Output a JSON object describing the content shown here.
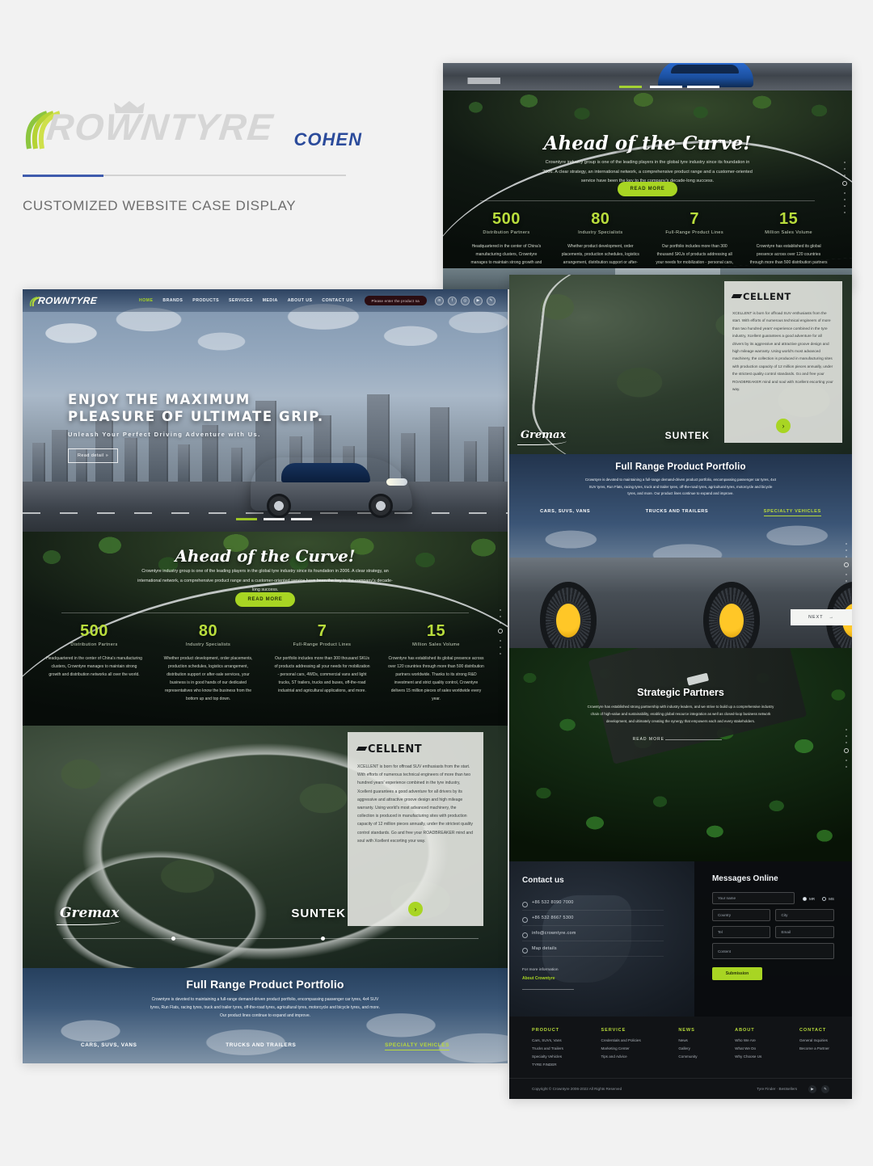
{
  "header": {
    "logo_word": "ROWNTYRE",
    "client": "COHEN",
    "subtitle": "CUSTOMIZED WEBSITE CASE DISPLAY"
  },
  "site": {
    "nav": {
      "logo": "ROWNTYRE",
      "items": [
        "HOME",
        "BRANDS",
        "PRODUCTS",
        "SERVICES",
        "MEDIA",
        "ABOUT US",
        "CONTACT US"
      ],
      "search_placeholder": "Please enter the product na",
      "social": [
        "in",
        "f",
        "◎",
        "▶",
        "✎"
      ]
    },
    "hero": {
      "title_line1": "ENJOY THE MAXIMUM",
      "title_line2": "PLEASURE OF ULTIMATE GRIP.",
      "subtitle": "Unleash Your Perfect Driving Adventure with Us.",
      "button": "Read detail »"
    },
    "curve": {
      "title": "Ahead of the Curve!",
      "paragraph": "Crowntyre industry group is one of the leading players in the global tyre industry since its foundation in 2006. A clear strategy, an international network, a comprehensive product range and a customer-oriented service have been the key to the company's decade-long success.",
      "button": "READ MORE",
      "stats": [
        {
          "num": "500",
          "label": "Distribution Partners",
          "desc": "Headquartered in the center of China's manufacturing clusters, Crowntyre manages to maintain strong growth and distribution networks all over the world."
        },
        {
          "num": "80",
          "label": "Industry Specialists",
          "desc": "Whether product development, order placements, production schedules, logistics arrangement, distribution support or after-sale services, your business is in good hands of our dedicated representatives who know the business from the bottom up and top down."
        },
        {
          "num": "7",
          "label": "Full-Range Product Lines",
          "desc": "Our portfolio includes more than 300 thousand SKUs of products addressing all your needs for mobilization - personal cars, 4WDs, commercial vans and light trucks, ST trailers, trucks and buses, off-the-road industrial and agricultural applications, and more."
        },
        {
          "num": "15",
          "label": "Million Sales Volume",
          "desc": "Crowntyre has established its global presence across over 120 countries through more than 500 distribution partners worldwide. Thanks to its strong R&D investment and strict quality control, Crowntyre delivers 15 million pieces of sales worldwide every year."
        }
      ]
    },
    "xcellent": {
      "logo": "CELLENT",
      "text": "XCELLENT is born for offroad SUV enthusiasts from the start. With efforts of numerous technical engineers of more than two hundred years' experience combined in the tyre industry, Xcellent guarantees a good adventure for all drivers by its aggressive and attractive groove design and high mileage warranty. Using world's most advanced machinery, the collection is produced in manufacturing sites with production capacity of 12 million pieces annually, under the strictest quality control standards. Go and free your ROADBREAKER mind and soul with Xcellent escorting your way.",
      "next": "›",
      "brands": [
        "Gremax",
        "SUNTEK"
      ]
    },
    "portfolio": {
      "title": "Full Range Product Portfolio",
      "paragraph": "Crowntyre is devoted to maintaining a full-range demand-driven product portfolio, encompassing passenger car tyres, 4x4 SUV tyres, Run Flats, racing tyres, truck and trailer tyres, off-the-road tyres, agricultural tyres, motorcycle and bicycle tyres, and more. Our product lines continue to expand and improve.",
      "tabs": [
        "CARS, SUVS, VANS",
        "TRUCKS AND TRAILERS",
        "SPECIALTY VEHICLES"
      ],
      "active_tab": "SPECIALTY VEHICLES",
      "next_button": "NEXT"
    },
    "partners": {
      "title": "Strategic Partners",
      "paragraph": "Crowntyre has established strong partnership with industry leaders, and we strive to build up a comprehensive industry chain of high-value and sustainability, enabling global resource integration as well as closed-loop business network development, and ultimately creating the synergy that empowers each and every stakeholders.",
      "button": "READ MORE"
    },
    "contact": {
      "title": "Contact us",
      "items": [
        "+86 532 8090 7000",
        "+86 532 8667 5300",
        "info@crowntyre.com",
        "Map details"
      ],
      "more_label": "For more information",
      "more_link": "About Crowntyre"
    },
    "messages": {
      "title": "Messages Online",
      "name_placeholder": "Your name",
      "gender": [
        "MR",
        "MS"
      ],
      "gender_selected": "MR",
      "country_placeholder": "Country",
      "city_placeholder": "City",
      "tel_placeholder": "Tel",
      "email_placeholder": "Email",
      "content_placeholder": "Content",
      "submit": "Submission"
    },
    "footer": {
      "columns": [
        {
          "title": "PRODUCT",
          "links": [
            "Cars, SUVs, Vans",
            "Trucks and Trailers",
            "Specialty Vehicles",
            "TYRE FINDER"
          ]
        },
        {
          "title": "SERVICE",
          "links": [
            "Credentials and Policies",
            "Marketing Center",
            "Tips and Advice"
          ]
        },
        {
          "title": "NEWS",
          "links": [
            "News",
            "Gallery",
            "Community"
          ]
        },
        {
          "title": "ABOUT",
          "links": [
            "Who We Are",
            "What We Do",
            "Why Choose Us"
          ]
        },
        {
          "title": "CONTACT",
          "links": [
            "General Inquiries",
            "Become a Partner"
          ]
        }
      ],
      "copyright": "Copyright © Crowntyre 2006-2022  All Rights Reserved",
      "links": "Tyre Finder · Bestsellers",
      "social": [
        "▶",
        "✎"
      ]
    }
  },
  "colors": {
    "accent_green": "#a8d523",
    "brand_blue": "#2b4b9b",
    "rule_blue": "#3f5bad"
  }
}
